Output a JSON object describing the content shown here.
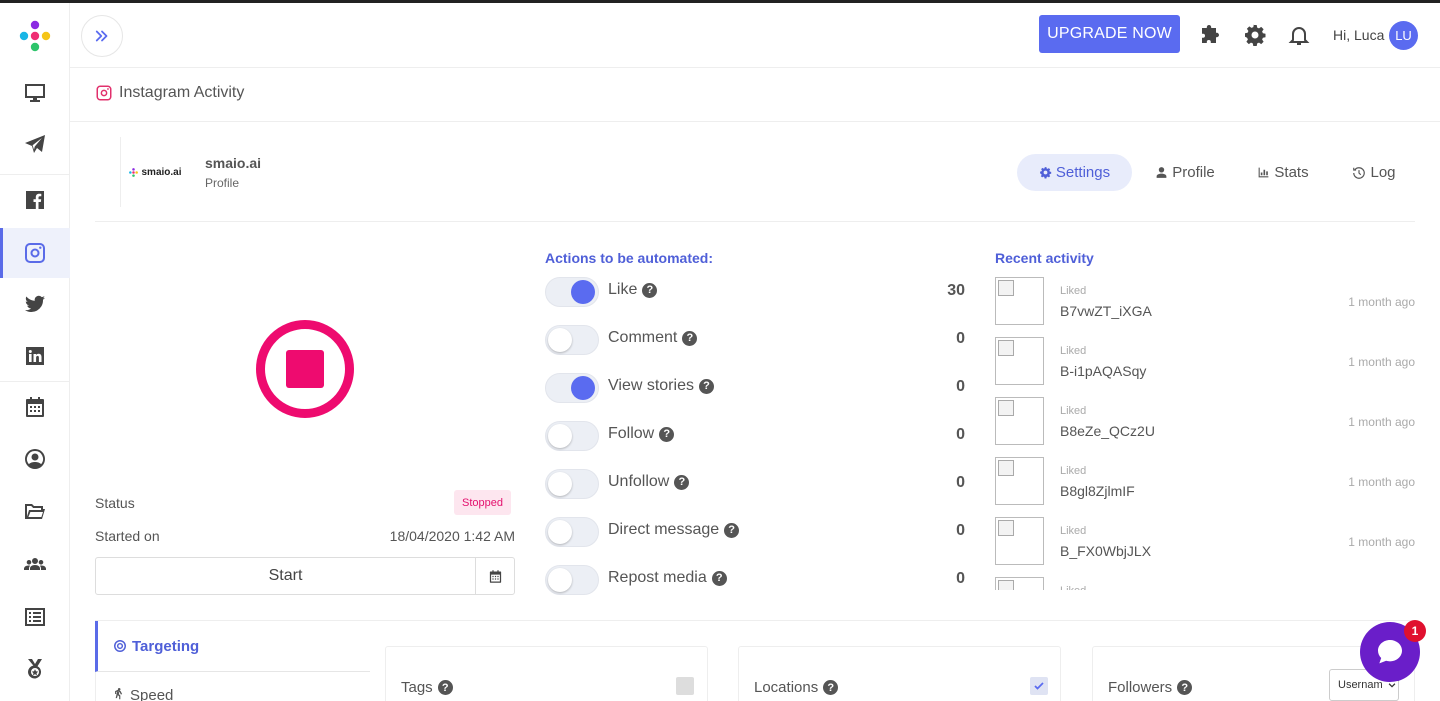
{
  "colors": {
    "accent": "#5a6bf0",
    "brand_pink": "#ee0b6f",
    "chat": "#6a1ec9",
    "badge_red": "#e0102f"
  },
  "sidebar": {
    "items": [
      {
        "icon": "monitor-icon"
      },
      {
        "icon": "paper-plane-icon"
      },
      {
        "icon": "facebook-icon"
      },
      {
        "icon": "instagram-icon",
        "active": true
      },
      {
        "icon": "twitter-icon"
      },
      {
        "icon": "linkedin-icon"
      },
      {
        "icon": "calendar-icon"
      },
      {
        "icon": "user-circle-icon"
      },
      {
        "icon": "folder-open-icon"
      },
      {
        "icon": "users-icon"
      },
      {
        "icon": "list-icon"
      },
      {
        "icon": "medal-icon"
      }
    ]
  },
  "header": {
    "upgrade_label": "UPGRADE NOW",
    "greeting": "Hi, Luca",
    "avatar_initials": "LU"
  },
  "page": {
    "title": "Instagram Activity"
  },
  "account": {
    "name": "smaio.ai",
    "subtitle": "Profile",
    "logo_text": "smaio.ai"
  },
  "profile_tabs": [
    {
      "label": "Settings",
      "icon": "gear-icon",
      "active": true
    },
    {
      "label": "Profile",
      "icon": "user-icon"
    },
    {
      "label": "Stats",
      "icon": "bar-chart-icon"
    },
    {
      "label": "Log",
      "icon": "history-icon"
    }
  ],
  "status": {
    "status_label": "Status",
    "status_value": "Stopped",
    "started_label": "Started on",
    "started_value": "18/04/2020 1:42 AM",
    "start_button": "Start"
  },
  "actions": {
    "title": "Actions to be automated:",
    "items": [
      {
        "label": "Like",
        "enabled": true,
        "count": "30"
      },
      {
        "label": "Comment",
        "enabled": false,
        "count": "0"
      },
      {
        "label": "View stories",
        "enabled": true,
        "count": "0"
      },
      {
        "label": "Follow",
        "enabled": false,
        "count": "0"
      },
      {
        "label": "Unfollow",
        "enabled": false,
        "count": "0"
      },
      {
        "label": "Direct message",
        "enabled": false,
        "count": "0"
      },
      {
        "label": "Repost media",
        "enabled": false,
        "count": "0"
      }
    ]
  },
  "recent": {
    "title": "Recent activity",
    "items": [
      {
        "kind": "Liked",
        "code": "B7vwZT_iXGA",
        "time": "1 month ago"
      },
      {
        "kind": "Liked",
        "code": "B-i1pAQASqy",
        "time": "1 month ago"
      },
      {
        "kind": "Liked",
        "code": "B8eZe_QCz2U",
        "time": "1 month ago"
      },
      {
        "kind": "Liked",
        "code": "B8gl8ZjlmIF",
        "time": "1 month ago"
      },
      {
        "kind": "Liked",
        "code": "B_FX0WbjJLX",
        "time": "1 month ago"
      },
      {
        "kind": "Liked",
        "code": "",
        "time": ""
      }
    ]
  },
  "targeting": {
    "tab_active": "Targeting",
    "tab_next": "Speed",
    "cards": [
      {
        "label": "Tags",
        "checked": false
      },
      {
        "label": "Locations",
        "checked": true
      },
      {
        "label": "Followers",
        "select_value": "Usernam"
      }
    ]
  },
  "chat": {
    "badge": "1"
  }
}
